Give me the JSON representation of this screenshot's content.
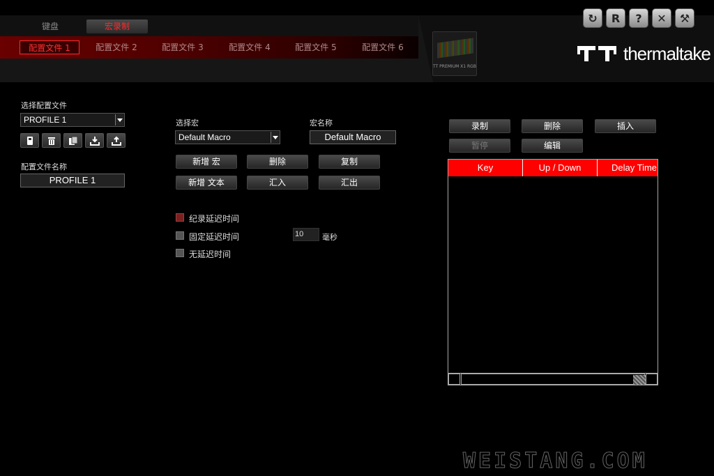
{
  "main_tabs": [
    {
      "label": "键盘"
    },
    {
      "label": "宏录制"
    }
  ],
  "profile_tabs": [
    {
      "label": "配置文件 1"
    },
    {
      "label": "配置文件 2"
    },
    {
      "label": "配置文件 3"
    },
    {
      "label": "配置文件 4"
    },
    {
      "label": "配置文件 5"
    },
    {
      "label": "配置文件 6"
    }
  ],
  "product": {
    "name": "TT PREMIUM X1 RGB"
  },
  "window_buttons": {
    "refresh": "↻",
    "reset": "R",
    "help": "?",
    "close": "✕",
    "settings": "⚒"
  },
  "brand": {
    "name": "thermaltake"
  },
  "left": {
    "select_profile_label": "选择配置文件",
    "profile_value": "PROFILE 1",
    "profile_name_label": "配置文件名称",
    "profile_name_value": "PROFILE 1"
  },
  "macro": {
    "select_macro_label": "选择宏",
    "macro_value": "Default Macro",
    "macro_name_label": "宏名称",
    "macro_name_value": "Default Macro",
    "buttons": {
      "new_macro": "新增 宏",
      "delete": "删除",
      "copy": "复制",
      "new_text": "新增 文本",
      "import": "汇入",
      "export": "汇出"
    },
    "options": {
      "record_delay": "纪录延迟时间",
      "fixed_delay": "固定延迟时间",
      "no_delay": "无延迟时间",
      "fixed_delay_value": "10",
      "unit": "毫秒"
    }
  },
  "record": {
    "buttons": {
      "record": "录制",
      "delete": "删除",
      "insert": "插入",
      "pause": "暂停",
      "edit": "编辑"
    },
    "table_headers": [
      "Key",
      "Up / Down",
      "Delay Time"
    ]
  },
  "colors": {
    "accent": "#ff0000",
    "active_tab": "#ff3030"
  },
  "watermark": "WEISTANG.COM"
}
